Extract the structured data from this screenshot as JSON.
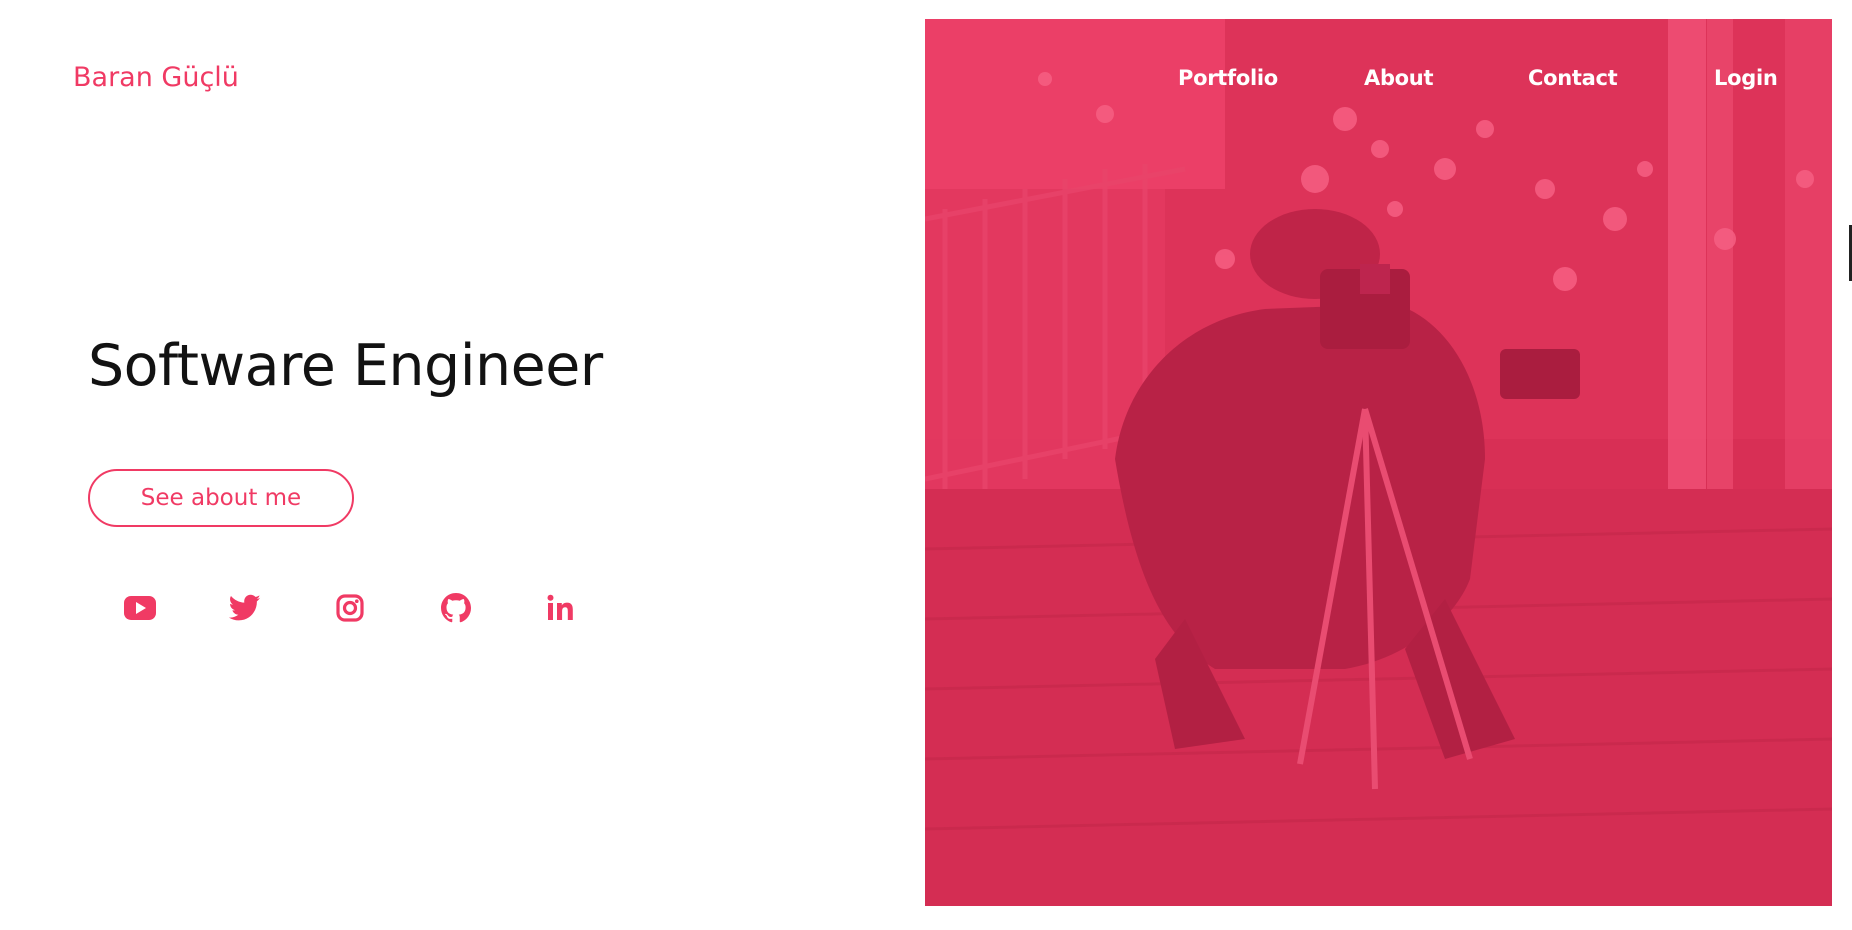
{
  "brand": {
    "name": "Baran Güçlü"
  },
  "nav": {
    "items": [
      {
        "label": "Portfolio"
      },
      {
        "label": "About"
      },
      {
        "label": "Contact"
      },
      {
        "label": "Login"
      }
    ]
  },
  "hero": {
    "title": "Software Engineer",
    "cta_label": "See about me",
    "image_icon": "photographer-with-camera-tripod-image"
  },
  "socials": [
    {
      "icon": "youtube-icon"
    },
    {
      "icon": "twitter-icon"
    },
    {
      "icon": "instagram-icon"
    },
    {
      "icon": "github-icon"
    },
    {
      "icon": "linkedin-icon"
    }
  ],
  "colors": {
    "accent": "#f03a64",
    "image_tint": "#d42c52",
    "text_dark": "#121212",
    "background": "#ffffff"
  }
}
